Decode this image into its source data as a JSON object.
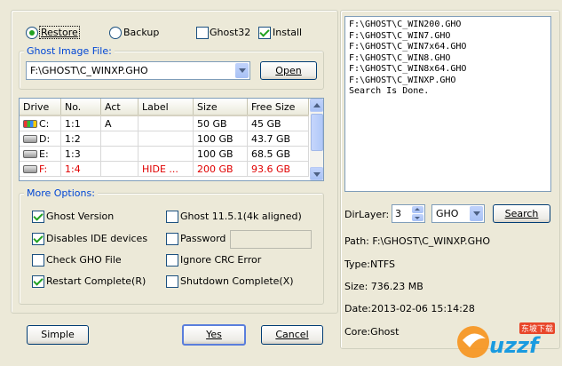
{
  "mode": {
    "restore_label": "Restore",
    "backup_label": "Backup",
    "selected": "restore",
    "ghost32_label": "Ghost32",
    "ghost32_checked": false,
    "install_label": "Install",
    "install_checked": true
  },
  "image_file": {
    "legend": "Ghost Image File:",
    "value": "F:\\GHOST\\C_WINXP.GHO",
    "open_label": "Open"
  },
  "drives": {
    "columns": [
      "Drive",
      "No.",
      "Act",
      "Label",
      "Size",
      "Free Size"
    ],
    "rows": [
      {
        "drive": "C:",
        "no": "1:1",
        "act": "A",
        "label": "",
        "size": "50 GB",
        "free": "45 GB",
        "highlight": false
      },
      {
        "drive": "D:",
        "no": "1:2",
        "act": "",
        "label": "",
        "size": "100 GB",
        "free": "43.7 GB",
        "highlight": false
      },
      {
        "drive": "E:",
        "no": "1:3",
        "act": "",
        "label": "",
        "size": "100 GB",
        "free": "68.5 GB",
        "highlight": false
      },
      {
        "drive": "F:",
        "no": "1:4",
        "act": "",
        "label": "HIDE ...",
        "size": "200 GB",
        "free": "93.6 GB",
        "highlight": true
      }
    ]
  },
  "options": {
    "legend": "More Options:",
    "ghost_version": {
      "label": "Ghost Version",
      "checked": true
    },
    "ghost_1151": {
      "label": "Ghost 11.5.1(4k aligned)",
      "checked": false
    },
    "disable_ide": {
      "label": "Disables IDE devices",
      "checked": true
    },
    "password": {
      "label": "Password",
      "checked": false,
      "value": ""
    },
    "check_gho": {
      "label": "Check GHO File",
      "checked": false
    },
    "ignore_crc": {
      "label": "Ignore CRC Error",
      "checked": false
    },
    "restart_complete": {
      "label": "Restart Complete(R)",
      "checked": true
    },
    "shutdown_complete": {
      "label": "Shutdown Complete(X)",
      "checked": false
    }
  },
  "buttons": {
    "simple": "Simple",
    "yes": "Yes",
    "cancel": "Cancel"
  },
  "log": {
    "lines": [
      "F:\\GHOST\\C_WIN200.GHO",
      "F:\\GHOST\\C_WIN7.GHO",
      "F:\\GHOST\\C_WIN7x64.GHO",
      "F:\\GHOST\\C_WIN8.GHO",
      "F:\\GHOST\\C_WIN8x64.GHO",
      "F:\\GHOST\\C_WINXP.GHO",
      "Search Is Done."
    ]
  },
  "search": {
    "dirlayer_label": "DirLayer:",
    "dirlayer_value": "3",
    "ext_value": "GHO",
    "search_label": "Search"
  },
  "details": {
    "path": "Path: F:\\GHOST\\C_WINXP.GHO",
    "type": "Type:NTFS",
    "size": "Size: 736.23 MB",
    "date": "Date:2013-02-06  15:14:28",
    "core": "Core:Ghost"
  },
  "watermark": {
    "text": "uzzf",
    "sub": "东坡下载"
  }
}
